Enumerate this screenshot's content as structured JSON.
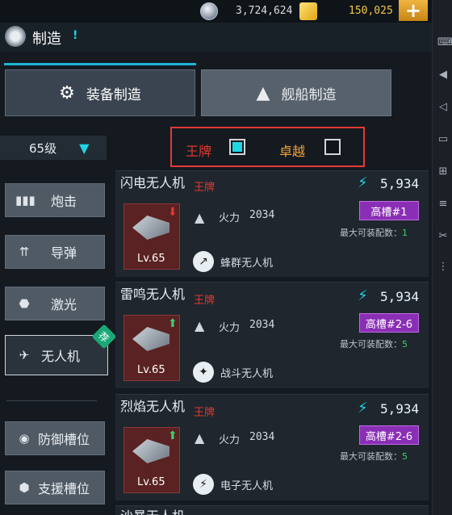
{
  "currency": {
    "crystal_amount": "3,724,624",
    "gold_amount": "150,025",
    "add_label": "+"
  },
  "header": {
    "title": "制造",
    "info_label": "!"
  },
  "main_tabs": [
    {
      "label": "装备制造"
    },
    {
      "label": "舰船制造"
    }
  ],
  "level_select": {
    "value": "65级",
    "arrow": "▾"
  },
  "filters": {
    "ace_label": "王牌",
    "ace_checked": true,
    "excellent_label": "卓越",
    "excellent_checked": false
  },
  "categories": [
    {
      "label": "炮击"
    },
    {
      "label": "导弹"
    },
    {
      "label": "激光"
    },
    {
      "label": "无人机",
      "recommend": "荐"
    },
    {
      "label": "防御槽位"
    },
    {
      "label": "支援槽位"
    }
  ],
  "items": [
    {
      "name": "闪电无人机",
      "rarity": "王牌",
      "power": "5,934",
      "slot": "高槽#1",
      "fire_label": "火力",
      "fire_value": "2034",
      "max_label": "最大可装配数：",
      "max_value": "1",
      "level": "Lv.65",
      "type": "蜂群无人机",
      "arrow_dir": "down"
    },
    {
      "name": "雷鸣无人机",
      "rarity": "王牌",
      "power": "5,934",
      "slot": "高槽#2-6",
      "fire_label": "火力",
      "fire_value": "2034",
      "max_label": "最大可装配数：",
      "max_value": "5",
      "level": "Lv.65",
      "type": "战斗无人机",
      "arrow_dir": "up"
    },
    {
      "name": "烈焰无人机",
      "rarity": "王牌",
      "power": "5,934",
      "slot": "高槽#2-6",
      "fire_label": "火力",
      "fire_value": "2034",
      "max_label": "最大可装配数：",
      "max_value": "5",
      "level": "Lv.65",
      "type": "电子无人机",
      "arrow_dir": "up"
    },
    {
      "name": "沙暴无人机"
    }
  ],
  "colors": {
    "accent_cyan": "#1fd6e6",
    "ace_red": "#e0392f",
    "excellent_orange": "#f0a03a",
    "slot_purple": "#8a2fb5",
    "max_green": "#3cd16a"
  }
}
